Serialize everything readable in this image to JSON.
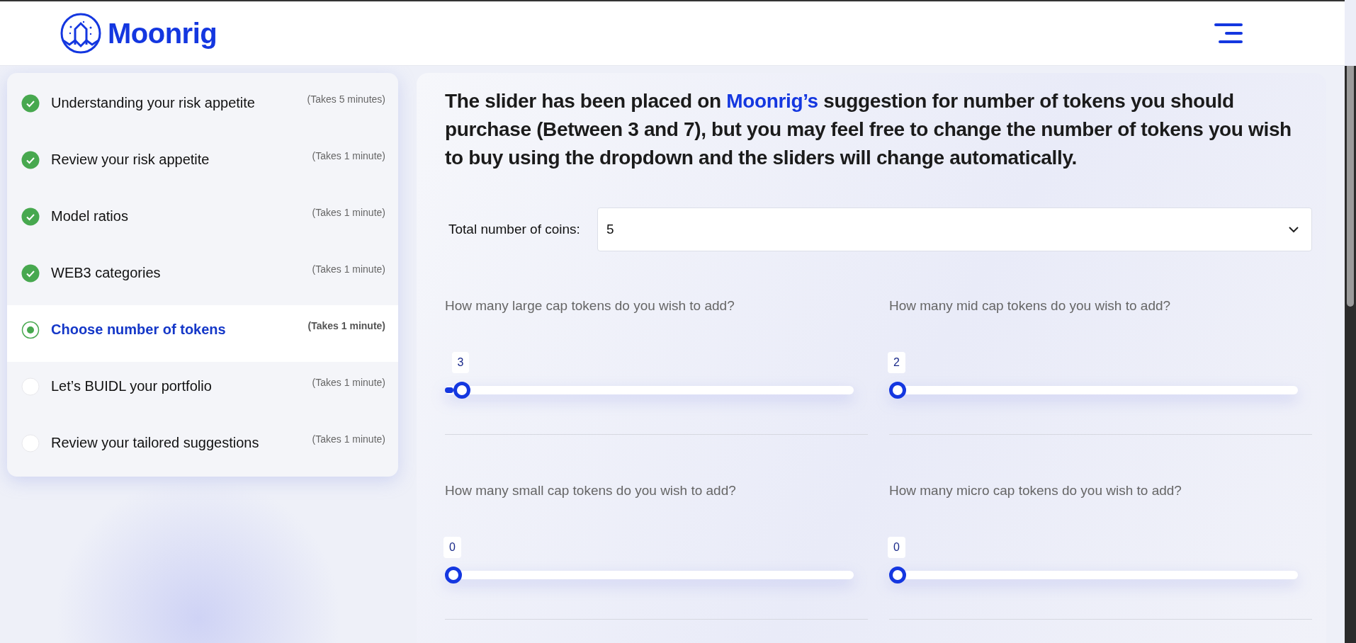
{
  "header": {
    "logo_text": "Moonrig"
  },
  "steps": [
    {
      "label": "Understanding your risk appetite",
      "duration": "(Takes 5 minutes)",
      "completed": true,
      "selected": false
    },
    {
      "label": "Review your risk appetite",
      "duration": "(Takes 1 minute)",
      "completed": true,
      "selected": false
    },
    {
      "label": "Model ratios",
      "duration": "(Takes 1 minute)",
      "completed": true,
      "selected": false
    },
    {
      "label": "WEB3 categories",
      "duration": "(Takes 1 minute)",
      "completed": true,
      "selected": false
    },
    {
      "label": "Choose number of tokens",
      "duration": "(Takes 1 minute)",
      "completed": false,
      "selected": true
    },
    {
      "label": "Let’s BUIDL your portfolio",
      "duration": "(Takes 1 minute)",
      "completed": false,
      "selected": false
    },
    {
      "label": "Review your tailored suggestions",
      "duration": "(Takes 1 minute)",
      "completed": false,
      "selected": false
    }
  ],
  "heading": [
    {
      "text": "The slider has been placed on ",
      "highlight": false
    },
    {
      "text": "Moonrig’s",
      "highlight": true
    },
    {
      "text": " suggestion for number of tokens you should purchase (Between 3 and 7), but you may feel free to change the number of tokens you wish to buy using the dropdown and the sliders will change automatically.",
      "highlight": false
    }
  ],
  "coins": {
    "label": "Total number of coins:",
    "value": "5"
  },
  "sliders": [
    {
      "question": "How many large cap tokens do you wish to add?",
      "reading": "3",
      "level": 0.02
    },
    {
      "question": "How many mid cap tokens do you wish to add?",
      "reading": "2",
      "level": 0
    },
    {
      "question": "How many small cap tokens do you wish to add?",
      "reading": "0",
      "level": 0
    },
    {
      "question": "How many micro cap tokens do you wish to add?",
      "reading": "0",
      "level": 0
    }
  ]
}
